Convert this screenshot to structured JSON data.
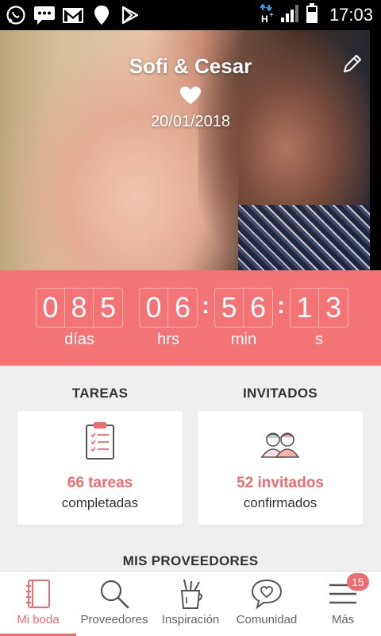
{
  "status_bar": {
    "time": "17:03",
    "icons_left": [
      "whatsapp-icon",
      "sms-icon",
      "gmail-icon",
      "maps-pin-icon",
      "play-store-icon"
    ],
    "icons_right": [
      "network-h-plus-icon",
      "signal-icon",
      "battery-icon"
    ]
  },
  "hero": {
    "couple_names": "Sofi & Cesar",
    "wedding_date": "20/01/2018"
  },
  "countdown": {
    "days": [
      "0",
      "8",
      "5"
    ],
    "hours": [
      "0",
      "6"
    ],
    "minutes": [
      "5",
      "6"
    ],
    "seconds": [
      "1",
      "3"
    ],
    "labels": {
      "days": "días",
      "hours": "hrs",
      "minutes": "min",
      "seconds": "s"
    }
  },
  "stats": {
    "tasks": {
      "title": "TAREAS",
      "value": "66 tareas",
      "label": "completadas"
    },
    "guests": {
      "title": "INVITADOS",
      "value": "52 invitados",
      "label": "confirmados"
    }
  },
  "vendors": {
    "title": "MIS PROVEEDORES"
  },
  "bottom_nav": {
    "items": [
      {
        "label": "Mi boda",
        "icon": "notebook-icon",
        "active": true
      },
      {
        "label": "Proveedores",
        "icon": "search-icon"
      },
      {
        "label": "Inspiración",
        "icon": "brush-cup-icon"
      },
      {
        "label": "Comunidad",
        "icon": "chat-heart-icon"
      },
      {
        "label": "Más",
        "icon": "menu-icon",
        "badge": "15"
      }
    ]
  },
  "colors": {
    "accent": "#f47476",
    "accent_text": "#ef6c6e",
    "background": "#efefef"
  }
}
